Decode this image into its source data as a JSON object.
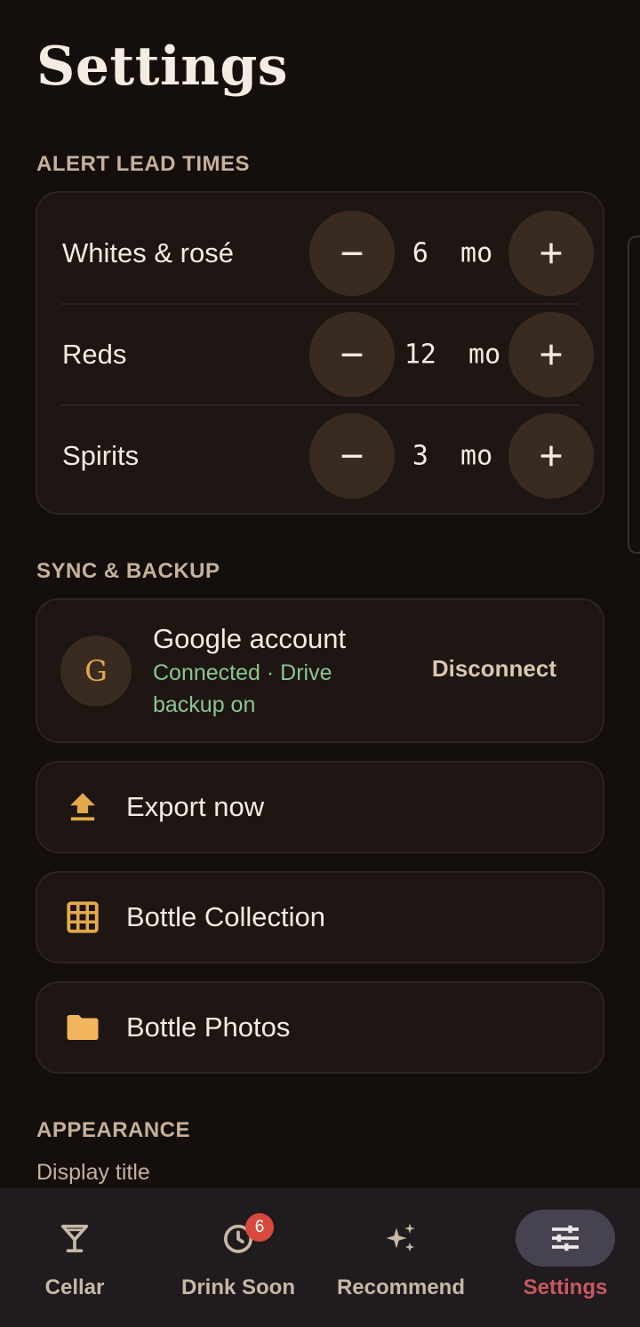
{
  "page": {
    "title": "Settings"
  },
  "alert_lead_times": {
    "label": "ALERT LEAD TIMES",
    "rows": [
      {
        "label": "Whites & rosé",
        "value": "6  mo"
      },
      {
        "label": "Reds",
        "value": "12  mo"
      },
      {
        "label": "Spirits",
        "value": "3  mo"
      }
    ]
  },
  "sync_backup": {
    "label": "SYNC & BACKUP",
    "account": {
      "avatar_letter": "G",
      "title": "Google account",
      "status": "Connected · Drive backup on",
      "disconnect_label": "Disconnect"
    },
    "actions": [
      {
        "label": "Export now",
        "icon": "upload-icon"
      },
      {
        "label": "Bottle Collection",
        "icon": "grid-icon"
      },
      {
        "label": "Bottle Photos",
        "icon": "folder-icon"
      }
    ]
  },
  "appearance": {
    "label": "APPEARANCE",
    "display_title_label": "Display title"
  },
  "nav": {
    "items": [
      {
        "label": "Cellar",
        "icon": "cocktail-glass-icon"
      },
      {
        "label": "Drink Soon",
        "icon": "clock-icon",
        "badge": "6"
      },
      {
        "label": "Recommend",
        "icon": "sparkles-icon"
      },
      {
        "label": "Settings",
        "icon": "sliders-icon",
        "active": true
      }
    ]
  },
  "colors": {
    "background": "#140e0c",
    "accent": "#e3a94d",
    "connected": "#8cc58e",
    "active_nav": "#c8585f",
    "badge": "#d84a3e"
  }
}
